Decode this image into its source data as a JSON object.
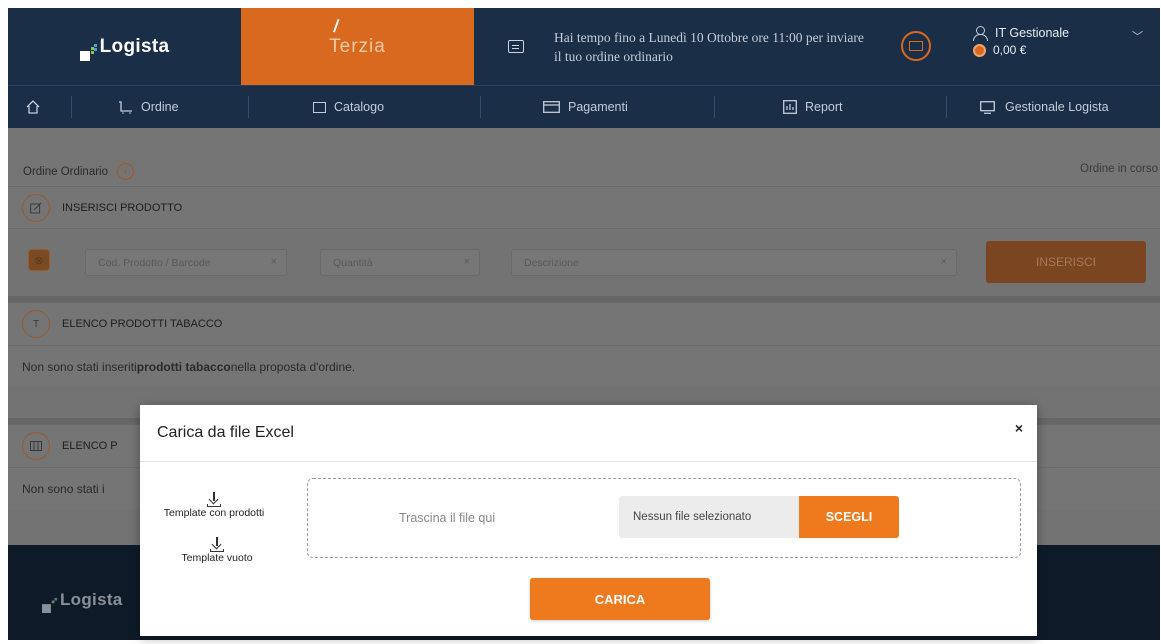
{
  "header": {
    "brand_logista": "Logista",
    "brand_terzia": "Terzia",
    "deadline_text": "Hai tempo fino a Lunedì 10 Ottobre ore 11:00 per inviare il tuo ordine ordinario",
    "user_name": "IT Gestionale",
    "user_credit": "0,00 €",
    "icons": [
      "chat-icon",
      "mail-icon",
      "user-icon",
      "chevron-down-icon",
      "coin-icon"
    ]
  },
  "nav": {
    "items": [
      {
        "label": "Ordine",
        "icon": "cart-icon"
      },
      {
        "label": "Catalogo",
        "icon": "catalog-icon"
      },
      {
        "label": "Pagamenti",
        "icon": "card-icon"
      },
      {
        "label": "Report",
        "icon": "report-icon"
      },
      {
        "label": "Gestionale Logista",
        "icon": "monitor-icon"
      }
    ]
  },
  "page": {
    "title": "Ordine Ordinario",
    "status": "Ordine in corso",
    "insert_section": {
      "label": "INSERISCI PRODOTTO",
      "code_placeholder": "Cod. Prodotto / Barcode",
      "qty_placeholder": "Quantità",
      "desc_placeholder": "Descrizione",
      "button": "INSERISCI"
    },
    "tobacco_section": {
      "circle": "T",
      "label": "ELENCO PRODOTTI TABACCO",
      "empty_pre": "Non sono stati inseriti ",
      "empty_bold": "prodotti tabacco",
      "empty_post": " nella proposta d'ordine."
    },
    "other_section": {
      "label": "ELENCO P",
      "empty": "Non sono stati i"
    }
  },
  "footer": {
    "brand": "Logista"
  },
  "modal": {
    "title": "Carica da file Excel",
    "close": "×",
    "template_with_products": "Template con prodotti",
    "template_empty": "Template vuoto",
    "drop_label": "Trascina il file qui",
    "file_name": "Nessun file selezionato",
    "choose_button": "SCEGLI",
    "upload_button": "CARICA"
  }
}
